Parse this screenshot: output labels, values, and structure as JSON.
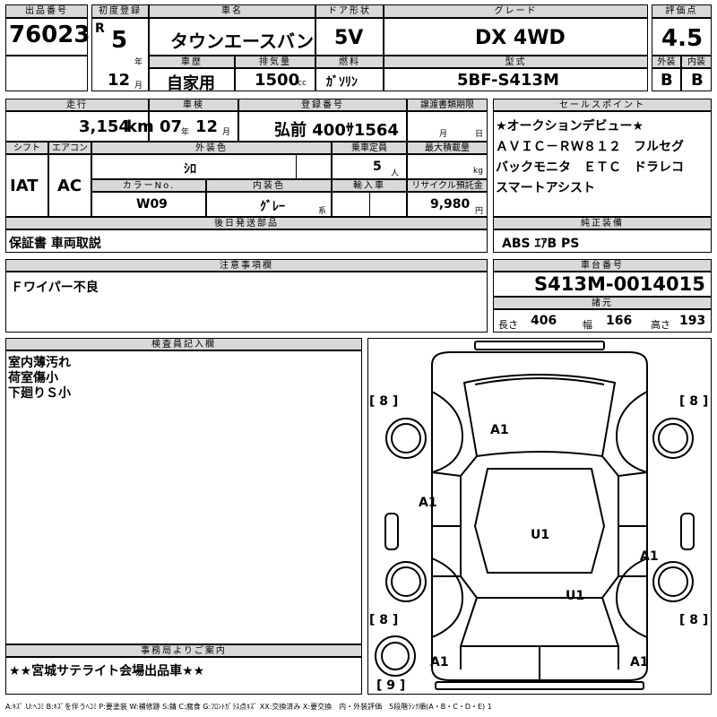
{
  "header_row1": {
    "lot_label": "出品番号",
    "lot": "76023",
    "first_reg_label": "初度登録",
    "era": "R",
    "year": "5",
    "year_unit": "年",
    "month": "12",
    "month_unit": "月",
    "car_name_label": "車名",
    "car_name": "タウンエースバン",
    "door_label": "ドア形状",
    "door": "5V",
    "grade_label": "グレード",
    "grade": "DX 4WD",
    "score_label": "評価点",
    "score": "4.5"
  },
  "header_row2": {
    "history_label": "車歴",
    "history": "自家用",
    "cc_label": "排気量",
    "cc": "1500",
    "cc_unit": "cc",
    "fuel_label": "燃料",
    "fuel": "ｶﾞｿﾘﾝ",
    "model_label": "型式",
    "model": "5BF-S413M",
    "ext_label": "外装",
    "ext": "B",
    "int_label": "内装",
    "int": "B"
  },
  "vehicle": {
    "mileage_label": "走行",
    "mileage": "3,154",
    "mileage_unit": "km",
    "inspection_label": "車検",
    "insp_year": "07",
    "insp_year_unit": "年",
    "insp_month": "12",
    "insp_month_unit": "月",
    "reg_no_label": "登録番号",
    "reg_no": "弘前 400ｻ1564",
    "transfer_label": "譲渡書類期限",
    "transfer_month": "月",
    "transfer_day": "日",
    "shift_label": "シフト",
    "shift": "IAT",
    "ac_label": "エアコン",
    "ac": "AC",
    "color_label": "外装色",
    "color": "ｼﾛ",
    "capacity_label": "乗車定員",
    "capacity": "5",
    "capacity_unit": "人",
    "load_label": "最大積載量",
    "load_unit": "kg",
    "color_no_label": "カラーNo.",
    "color_no": "W09",
    "int_color_label": "内装色",
    "int_color": "ｸﾞﾚｰ",
    "int_color_unit": "系",
    "import_label": "輸入車",
    "recycle_label": "リサイクル預託金",
    "recycle": "9,980",
    "recycle_unit": "円"
  },
  "sales_points": {
    "label": "セールスポイント",
    "lines": [
      "★オークションデビュー★",
      "ＡＶＩＣ－ＲＷ８１２　フルセグ",
      "バックモニタ　ＥＴＣ　ドラレコ",
      "スマートアシスト"
    ]
  },
  "later_parts": {
    "label": "後日発送部品",
    "value": "保証書 車両取説"
  },
  "equipment": {
    "label": "純正装備",
    "value": "ABS ｴｱB PS"
  },
  "notes": {
    "label": "注意事項欄",
    "value": "Ｆワイパー不良"
  },
  "chassis": {
    "label": "車台番号",
    "value": "S413M-0014015"
  },
  "specs": {
    "label": "諸元",
    "length_label": "長さ",
    "length": "406",
    "width_label": "幅",
    "width": "166",
    "height_label": "高さ",
    "height": "193"
  },
  "inspector": {
    "label": "検査員記入欄",
    "lines": [
      "室内薄汚れ",
      "荷室傷小",
      "下廻りＳ小"
    ]
  },
  "office": {
    "label": "事務局よりご案内",
    "value": "★★宮城サテライト会場出品車★★"
  },
  "diagram": {
    "tread_fl": "8",
    "tread_fr": "8",
    "tread_rl": "8",
    "tread_rr": "8",
    "tread_spare": "9",
    "mark_hood": "A1",
    "mark_left_front_door": "A1",
    "mark_roof": "U1",
    "mark_right_rear": "A1",
    "mark_rear_floor": "U1",
    "mark_rear_left": "A1",
    "mark_rear_right": "A1"
  },
  "legend": "A:ｷｽﾞ U:ﾍｺﾐ B:ｷｽﾞを伴うﾍｺﾐ P:要塗装 W:補修跡 S:錆 C:腐食 G:ﾌﾛﾝﾄｶﾞﾗｽ点ｷｽﾞ XX:交換済み X:要交換　内・外装評価　5段階ﾗﾝｸ順(A・B・C・D・E) 1"
}
